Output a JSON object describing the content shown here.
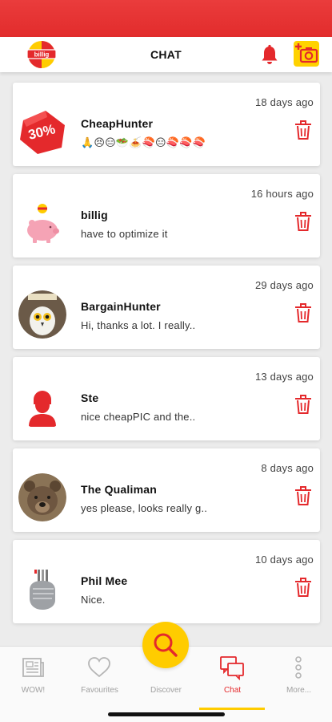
{
  "header": {
    "title": "CHAT",
    "logo_text": "billig",
    "bell_icon": "bell-icon",
    "camera_icon": "add-photo-camera-icon"
  },
  "colors": {
    "brand_red": "#e4292c",
    "accent_yellow": "#ffcc00",
    "background": "#ececec"
  },
  "chats": [
    {
      "name": "CheapHunter",
      "preview": "🙏😣😑🥗🍝🍣😑🍣🍣🍣",
      "time": "18 days ago",
      "avatar_text": "30%"
    },
    {
      "name": "billig",
      "preview": "have to optimize it",
      "time": "16 hours ago"
    },
    {
      "name": "BargainHunter",
      "preview": "Hi, thanks a lot. I really..",
      "time": "29 days ago"
    },
    {
      "name": "Ste",
      "preview": "nice cheapPIC and the..",
      "time": "13 days ago"
    },
    {
      "name": "The Qualiman",
      "preview": "yes please, looks really g..",
      "time": "8 days ago"
    },
    {
      "name": "Phil Mee",
      "preview": "Nice.",
      "time": "10 days ago"
    }
  ],
  "tabs": [
    {
      "label": "WOW!",
      "icon": "newspaper-icon"
    },
    {
      "label": "Favourites",
      "icon": "heart-icon"
    },
    {
      "label": "Discover",
      "icon": "search-icon"
    },
    {
      "label": "Chat",
      "icon": "chat-bubbles-icon",
      "active": true
    },
    {
      "label": "More...",
      "icon": "more-dots-icon"
    }
  ]
}
